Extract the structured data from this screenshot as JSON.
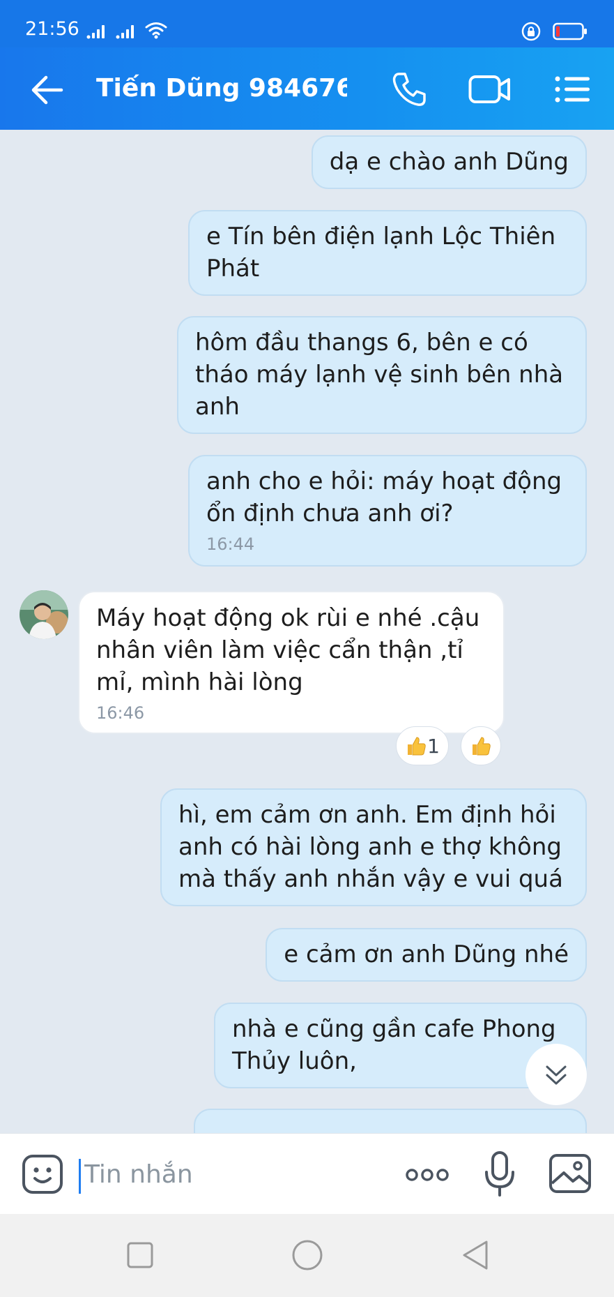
{
  "status_bar": {
    "time": "21:56"
  },
  "header": {
    "contact_name": "Tiến Dũng 984676..."
  },
  "messages": [
    {
      "direction": "sent",
      "text": "dạ e chào anh Dũng"
    },
    {
      "direction": "sent",
      "text": "e Tín bên điện lạnh Lộc Thiên\nPhát"
    },
    {
      "direction": "sent",
      "text": "hôm đầu thangs 6, bên e có\ntháo máy lạnh vệ sinh bên nhà\nanh"
    },
    {
      "direction": "sent",
      "text": "anh cho e hỏi: máy hoạt động\nổn định chưa anh ơi?",
      "time": "16:44"
    },
    {
      "direction": "received",
      "text": "Máy hoạt động ok rùi e nhé .cậu\nnhân viên làm việc cẩn thận ,tỉ\nmỉ, mình hài lòng",
      "time": "16:46",
      "reaction_count": "1"
    },
    {
      "direction": "sent",
      "text": "hì, em cảm ơn anh. Em định hỏi\nanh có hài lòng anh e thợ không\nmà thấy anh nhắn vậy e vui quá"
    },
    {
      "direction": "sent",
      "text": "e cảm ơn anh Dũng nhé"
    },
    {
      "direction": "sent",
      "text": "nhà e cũng gần cafe Phong\nThủy luôn,"
    }
  ],
  "composer": {
    "placeholder": "Tin nhắn"
  },
  "icons": {
    "back": "arrow-left-icon",
    "call": "phone-icon",
    "video": "video-camera-icon",
    "menu": "list-menu-icon",
    "emoji": "sticker-face-icon",
    "more": "three-dots-icon",
    "mic": "microphone-icon",
    "gallery": "image-icon",
    "like": "thumbs-up-icon",
    "scroll_down": "double-chevron-down-icon"
  },
  "colors": {
    "header": "#1877ec",
    "sent_bubble": "#d6ecfb",
    "received_bubble": "#ffffff",
    "chat_background": "#e2e9f1",
    "cursor": "#1f7df1"
  }
}
